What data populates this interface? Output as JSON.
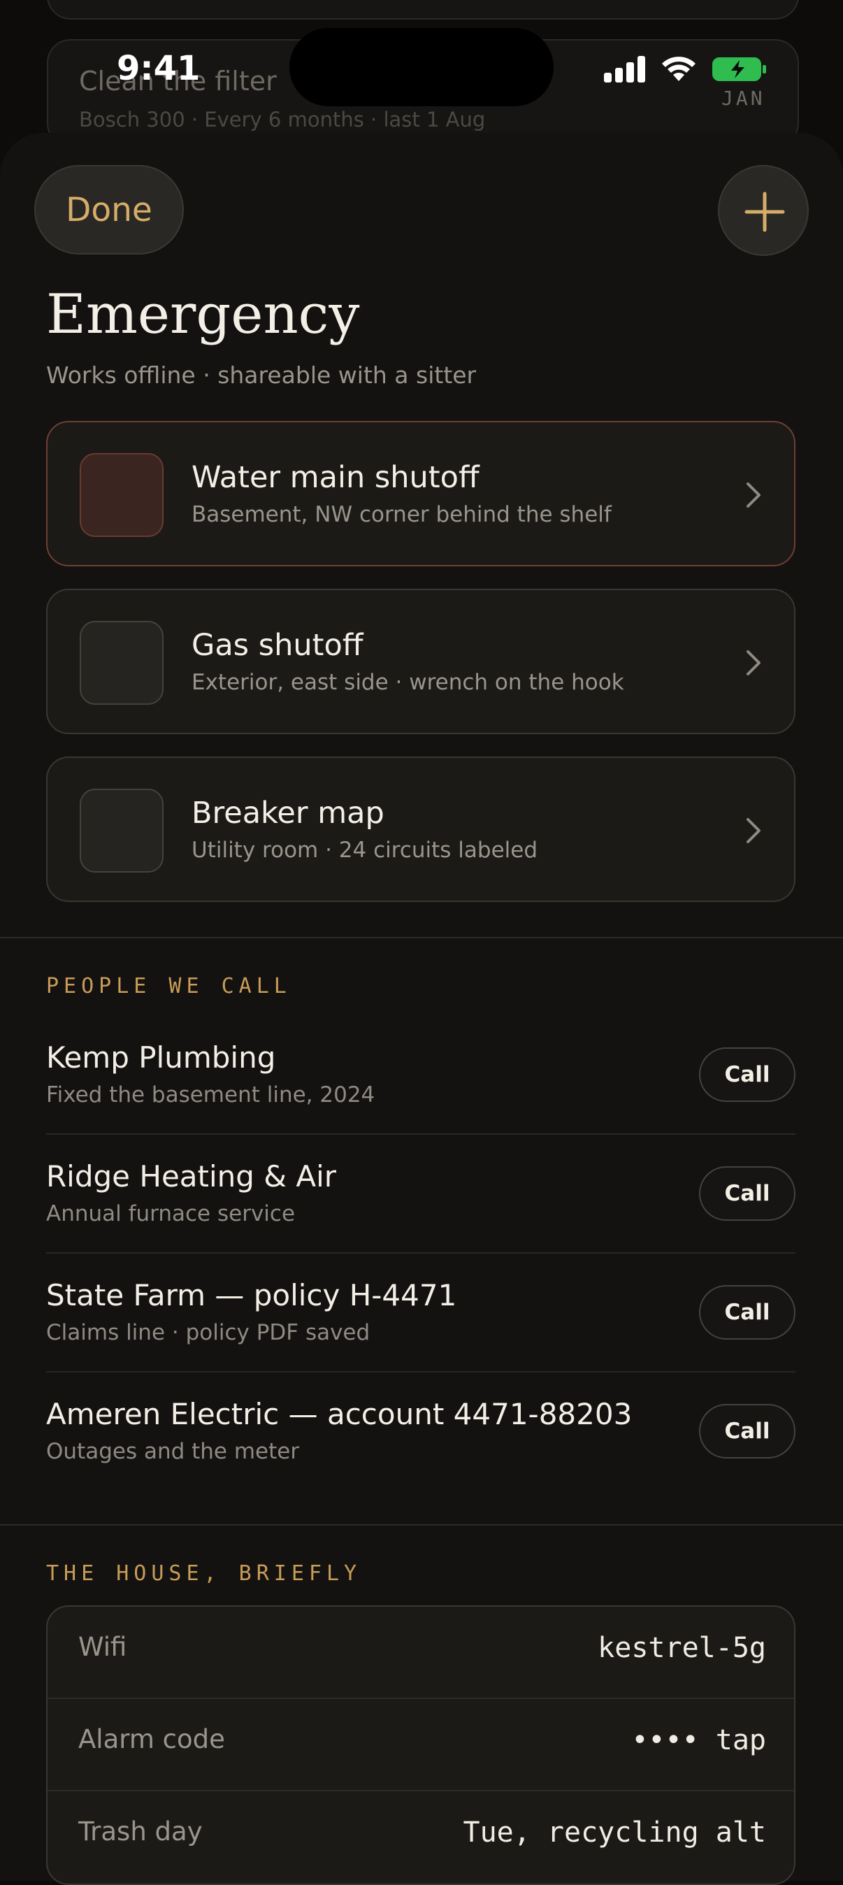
{
  "background_card": {
    "title": "Clean the filter",
    "subtitle": "Bosch 300 · Every 6 months · last 1 Aug",
    "month_badge": "JAN"
  },
  "status_bar": {
    "time": "9:41"
  },
  "header": {
    "done_label": "Done",
    "title": "Emergency",
    "subtitle": "Works offline · shareable with a sitter"
  },
  "emergency_items": [
    {
      "title": "Water main shutoff",
      "subtitle": "Basement, NW corner behind the shelf"
    },
    {
      "title": "Gas shutoff",
      "subtitle": "Exterior, east side · wrench on the hook"
    },
    {
      "title": "Breaker map",
      "subtitle": "Utility room · 24 circuits labeled"
    }
  ],
  "people": {
    "section_label": "PEOPLE WE CALL",
    "call_label": "Call",
    "items": [
      {
        "name": "Kemp Plumbing",
        "note": "Fixed the basement line, 2024"
      },
      {
        "name": "Ridge Heating & Air",
        "note": "Annual furnace service"
      },
      {
        "name": "State Farm — policy H-4471",
        "note": "Claims line · policy PDF saved"
      },
      {
        "name": "Ameren Electric — account 4471-88203",
        "note": "Outages and the meter"
      }
    ]
  },
  "house": {
    "section_label": "THE HOUSE, BRIEFLY",
    "rows": [
      {
        "label": "Wifi",
        "value": "kestrel-5g"
      },
      {
        "label": "Alarm code",
        "value": "•••• tap"
      },
      {
        "label": "Trash day",
        "value": "Tue, recycling alt"
      }
    ]
  },
  "colors": {
    "accent": "#d6ad68",
    "alert_border": "#6f3f33",
    "background": "#131211"
  }
}
